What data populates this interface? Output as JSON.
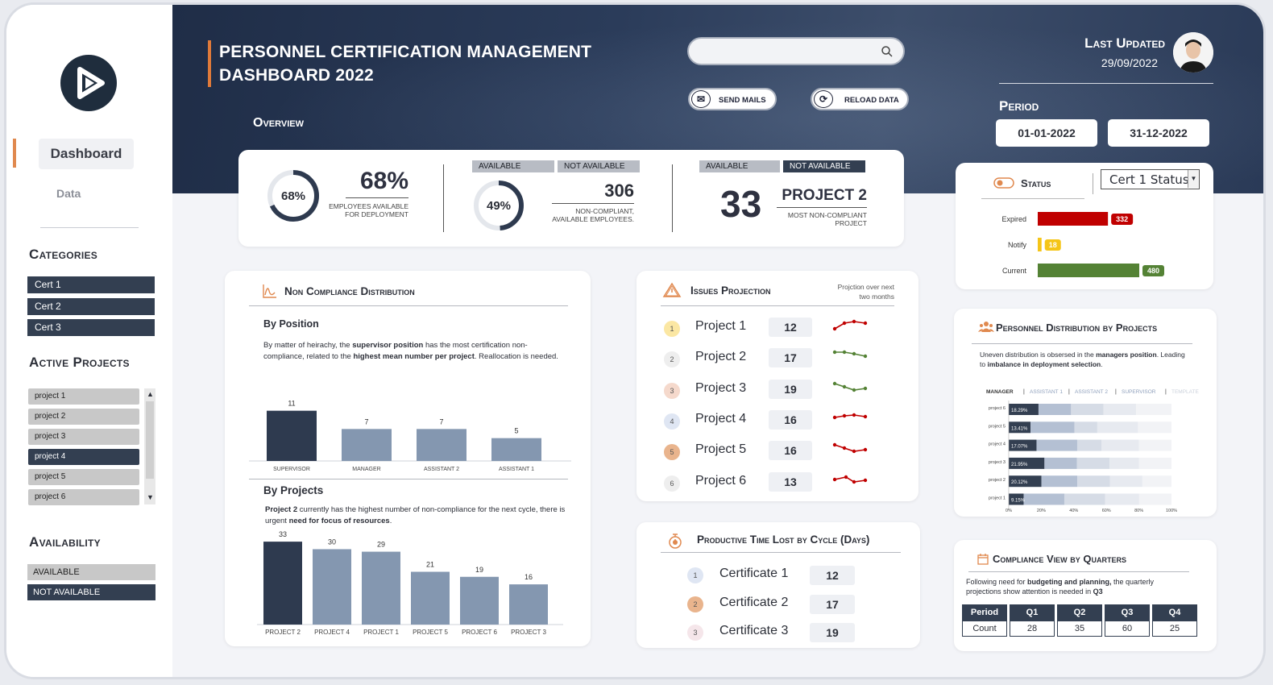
{
  "sidebar": {
    "nav": [
      {
        "label": "Dashboard"
      },
      {
        "label": "Data"
      }
    ],
    "categories_title": "Categories",
    "categories": [
      "Cert 1",
      "Cert 2",
      "Cert 3"
    ],
    "projects_title": "Active Projects",
    "projects": [
      {
        "label": "project 1",
        "selected": false
      },
      {
        "label": "project 2",
        "selected": false
      },
      {
        "label": "project 3",
        "selected": false
      },
      {
        "label": "project 4",
        "selected": true
      },
      {
        "label": "project 5",
        "selected": false
      },
      {
        "label": "project 6",
        "selected": false
      }
    ],
    "availability_title": "Availability",
    "availability": [
      {
        "label": "AVAILABLE",
        "selected": false
      },
      {
        "label": "NOT AVAILABLE",
        "selected": true
      }
    ]
  },
  "header": {
    "title_line1": "PERSONNEL CERTIFICATION MANAGEMENT",
    "title_line2": "DASHBOARD 2022",
    "search_placeholder": "",
    "send_mails": "SEND MAILS",
    "reload_data": "RELOAD DATA",
    "overview": "Overview",
    "last_updated_label": "Last Updated",
    "last_updated_date": "29/09/2022",
    "period_label": "Period",
    "period_start": "01-01-2022",
    "period_end": "31-12-2022"
  },
  "kpis": {
    "ring1_label": "68%",
    "ring1_value": 0.68,
    "big1": "68%",
    "big1_caption1": "EMPLOYEES AVAILABLE",
    "big1_caption2": "FOR DEPLOYMENT",
    "tag_available": "AVAILABLE",
    "tag_not_available": "NOT AVAILABLE",
    "ring2_label": "49%",
    "ring2_value": 0.49,
    "big2": "306",
    "big2_caption1": "NON-COMPLIANT,",
    "big2_caption2": "AVAILABLE EMPLOYEES.",
    "big3_num": "33",
    "big3_name": "PROJECT 2",
    "big3_caption1": "MOST NON-COMPLIANT",
    "big3_caption2": "PROJECT"
  },
  "status": {
    "title": "Status",
    "select_value": "Cert 1 Status",
    "bars": [
      {
        "label": "Expired",
        "value": 332,
        "color": "#c00000"
      },
      {
        "label": "Notify",
        "value": 18,
        "color": "#f5c518"
      },
      {
        "label": "Current",
        "value": 480,
        "color": "#548235"
      }
    ]
  },
  "noncompliance": {
    "title": "Non Compliance Distribution",
    "by_position_title": "By Position",
    "by_position_text_1": "By matter of heirachy, the ",
    "by_position_text_b1": "supervisor position",
    "by_position_text_2": " has the most certification non-compliance, related to the ",
    "by_position_text_b2": "highest mean number per project",
    "by_position_text_3": ". Reallocation is needed.",
    "by_projects_title": "By Projects",
    "by_projects_text_b1": "Project 2",
    "by_projects_text_1": " currently has the highest number of non-compliance for the next cycle, there is urgent ",
    "by_projects_text_b2": "need for focus of resources",
    "by_projects_text_2": "."
  },
  "issues": {
    "title": "Issues Projection",
    "note1": "Projction over next",
    "note2": "two months",
    "rows": [
      {
        "name": "Project 1",
        "num": "1",
        "value": "12",
        "trend": "up",
        "color": "#c00000",
        "badge": "#fbe7a3"
      },
      {
        "name": "Project 2",
        "num": "2",
        "value": "17",
        "trend": "down",
        "color": "#548235",
        "badge": "#eeeeee"
      },
      {
        "name": "Project 3",
        "num": "3",
        "value": "19",
        "trend": "dip",
        "color": "#548235",
        "badge": "#f5d9cc"
      },
      {
        "name": "Project 4",
        "num": "4",
        "value": "16",
        "trend": "flat",
        "color": "#c00000",
        "badge": "#dfe6f3"
      },
      {
        "name": "Project 5",
        "num": "5",
        "value": "16",
        "trend": "dip",
        "color": "#c00000",
        "badge": "#e9b48d"
      },
      {
        "name": "Project 6",
        "num": "6",
        "value": "13",
        "trend": "peak",
        "color": "#c00000",
        "badge": "#eeeeee"
      }
    ]
  },
  "timelost": {
    "title": "Productive Time Lost by Cycle (Days)",
    "rows": [
      {
        "name": "Certificate 1",
        "num": "1",
        "value": "12",
        "badge": "#dfe6f3"
      },
      {
        "name": "Certificate 2",
        "num": "2",
        "value": "17",
        "badge": "#e9b48d"
      },
      {
        "name": "Certificate 3",
        "num": "3",
        "value": "19",
        "badge": "#f5e6ea"
      }
    ]
  },
  "distribution": {
    "title": "Personnel Distribution by Projects",
    "text_1": "Uneven distribution is obsersed in the ",
    "text_b1": "managers position",
    "text_2": ". Leading to ",
    "text_b2": "imbalance in deployment selection",
    "text_3": "."
  },
  "quarters": {
    "title": "Compliance View by Quarters",
    "text_1": "Following need for ",
    "text_b1": "budgeting and planning,",
    "text_2": " the quarterly projections show attention is needed in ",
    "text_b2": "Q3",
    "headers": [
      "Period",
      "Q1",
      "Q2",
      "Q3",
      "Q4"
    ],
    "row_label": "Count",
    "values": [
      "28",
      "35",
      "60",
      "25"
    ]
  },
  "chart_data": [
    {
      "type": "bar",
      "title": "By Position",
      "categories": [
        "SUPERVISOR",
        "MANAGER",
        "ASSISTANT 2",
        "ASSISTANT 1"
      ],
      "values": [
        11,
        7,
        7,
        5
      ],
      "ylim": [
        0,
        12
      ],
      "colors": [
        "#2e3a4f",
        "#8497b0",
        "#8497b0",
        "#8497b0"
      ]
    },
    {
      "type": "bar",
      "title": "By Projects",
      "categories": [
        "PROJECT 2",
        "PROJECT 4",
        "PROJECT 1",
        "PROJECT 5",
        "PROJECT 6",
        "PROJECT 3"
      ],
      "values": [
        33,
        30,
        29,
        21,
        19,
        16
      ],
      "ylim": [
        0,
        34
      ],
      "colors": [
        "#2e3a4f",
        "#8497b0",
        "#8497b0",
        "#8497b0",
        "#8497b0",
        "#8497b0"
      ]
    },
    {
      "type": "bar",
      "title": "Personnel Distribution by Projects",
      "orientation": "horizontal",
      "stacked": true,
      "legend": [
        "MANAGER",
        "ASSISTANT 1",
        "ASSISTANT 2",
        "SUPERVISOR",
        "TEMPLATE"
      ],
      "categories": [
        "project 6",
        "project 5",
        "project 4",
        "project 3",
        "project 2",
        "project 1"
      ],
      "series": [
        {
          "name": "MANAGER",
          "values": [
            18.29,
            13.41,
            17.07,
            21.95,
            20.12,
            9.15
          ],
          "color": "#333f51"
        },
        {
          "name": "ASSISTANT 1",
          "values": [
            20,
            27,
            25,
            20,
            22,
            25
          ],
          "color": "#b4c0d3"
        },
        {
          "name": "ASSISTANT 2",
          "values": [
            20,
            14,
            15,
            20,
            20,
            25
          ],
          "color": "#d6dce6"
        },
        {
          "name": "SUPERVISOR",
          "values": [
            20,
            25,
            23,
            18,
            20,
            21
          ],
          "color": "#e7eaf0"
        },
        {
          "name": "TEMPLATE",
          "values": [
            21.71,
            20.59,
            19.93,
            20.05,
            17.88,
            19.85
          ],
          "color": "#f2f3f6"
        }
      ],
      "labels": [
        "18.29%",
        "13.41%",
        "17.07%",
        "21.95%",
        "20.12%",
        "9.15%"
      ],
      "xticks": [
        "0%",
        "20%",
        "40%",
        "60%",
        "80%",
        "100%"
      ]
    }
  ]
}
